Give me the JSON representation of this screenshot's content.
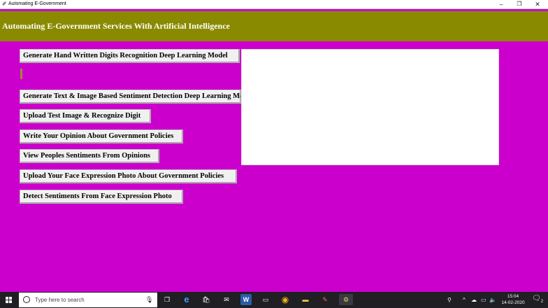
{
  "window": {
    "title": "Automating E-Government",
    "icons": {
      "app": "feather-icon",
      "minimize": "minimize-icon",
      "maximize": "maximize-icon",
      "close": "close-icon"
    }
  },
  "header": {
    "title": "Automating E-Government Services With Artificial Intelligence",
    "background": "#8a8a00",
    "text_color": "#ffffff"
  },
  "colors": {
    "page_background": "#cc00cc"
  },
  "buttons": [
    {
      "label": "Generate Hand Written Digits Recognition Deep Learning Model"
    },
    {
      "label": "Generate Text & Image Based Sentiment Detection Deep Learning Model"
    },
    {
      "label": "Upload Test Image & Recognize Digit"
    },
    {
      "label": "Write Your Opinion About Government Policies"
    },
    {
      "label": "View Peoples Sentiments From Opinions"
    },
    {
      "label": "Upload Your Face Expression Photo About Government Policies"
    },
    {
      "label": "Detect Sentiments From Face Expression Photo"
    }
  ],
  "progress": {
    "value": 0.01,
    "color": "#a08a2a"
  },
  "output": {
    "text": ""
  },
  "taskbar": {
    "search_placeholder": "Type here to search",
    "apps": [
      {
        "icon": "task-view-icon",
        "glyph": "❐"
      },
      {
        "icon": "edge-icon",
        "glyph": "e"
      },
      {
        "icon": "store-icon",
        "glyph": "🛍"
      },
      {
        "icon": "mail-icon",
        "glyph": "✉"
      },
      {
        "icon": "word-icon",
        "glyph": "W"
      },
      {
        "icon": "terminal-icon",
        "glyph": "▭"
      },
      {
        "icon": "chrome-icon",
        "glyph": "◉"
      },
      {
        "icon": "file-explorer-icon",
        "glyph": "▬"
      },
      {
        "icon": "paint-icon",
        "glyph": "✎"
      },
      {
        "icon": "python-icon",
        "glyph": "⚙"
      }
    ],
    "tray": {
      "people": "⚲",
      "chevron": "^",
      "network": "☁",
      "battery": "▭",
      "volume": "🔈"
    },
    "time": "15:04",
    "date": "14-02-2020",
    "notifications": "2"
  }
}
